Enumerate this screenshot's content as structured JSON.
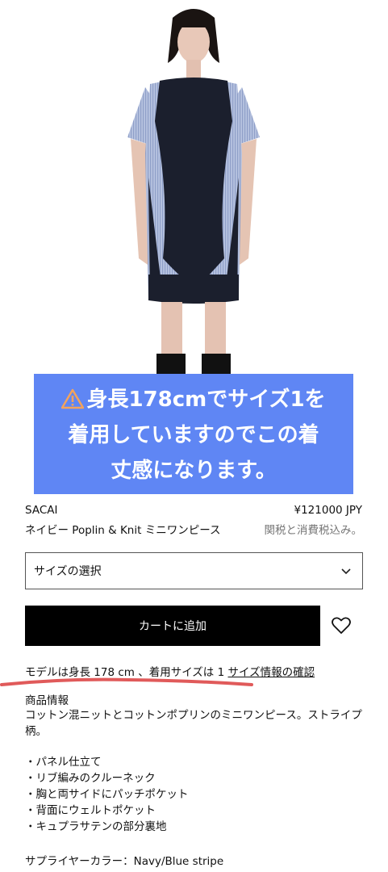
{
  "banner": {
    "warning_icon": "warning-icon",
    "line1": "身長178cmでサイズ1を",
    "line2": "着用していますのでこの着",
    "line3": "丈感になります。"
  },
  "product": {
    "brand": "SACAI",
    "price": "¥121000 JPY",
    "name": "ネイビー Poplin & Knit ミニワンピース",
    "tax_note": "関税と消費税込み。"
  },
  "size_select": {
    "label": "サイズの選択",
    "icon": "chevron-down-icon"
  },
  "cart": {
    "button_label": "カートに追加",
    "wishlist_icon": "heart-icon"
  },
  "model_info": {
    "text": "モデルは身長 178 cm 、着用サイズは 1 ",
    "link": "サイズ情報の確認"
  },
  "details": {
    "title": "商品情報",
    "description": "コットン混ニットとコットンポプリンのミニワンピース。ストライプ柄。",
    "bullets": [
      "・パネル仕立て",
      "・リブ編みのクルーネック",
      "・胸と両サイドにパッチポケット",
      "・背面にウェルトポケット",
      "・キュプラサテンの部分裏地"
    ],
    "supplier_color": "サプライヤーカラー：Navy/Blue stripe"
  },
  "colors": {
    "banner_bg": "#5f86f4",
    "dress_navy": "#1b1f2d",
    "stripe_blue": "#9fb0d6",
    "annotation_red": "#e05a5a"
  }
}
